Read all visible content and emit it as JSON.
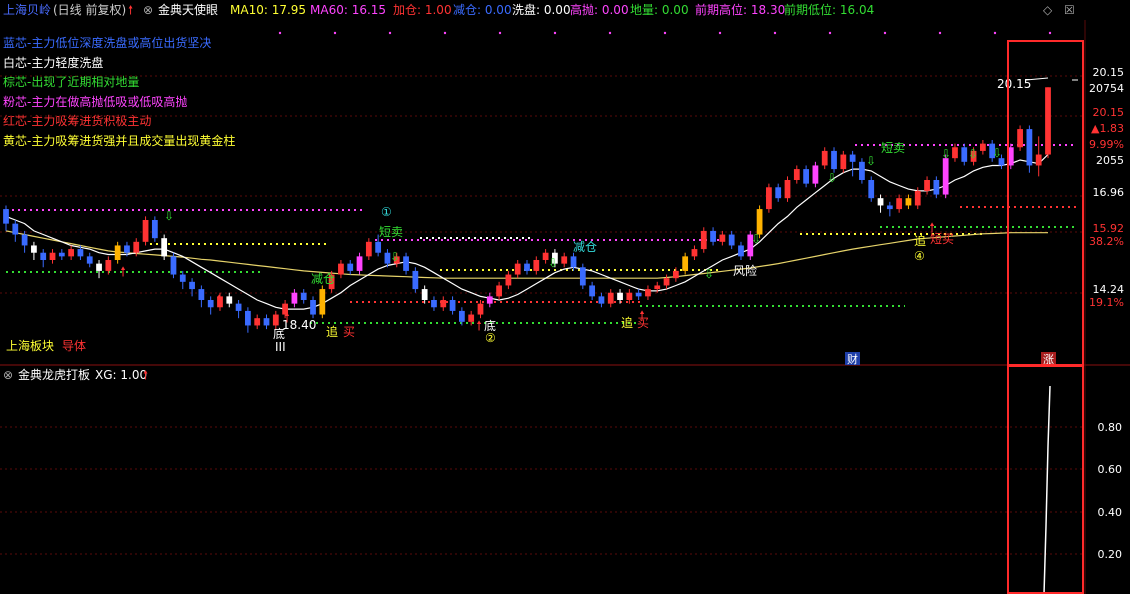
{
  "header": {
    "stock_name": "上海贝岭",
    "period": "(日线 前复权)",
    "indicator_name": "金典天使眼",
    "ma10_label": "MA10: 17.95",
    "ma60_label": "MA60: 16.15",
    "jiacang_label": "加仓: 1.00",
    "jiancang_label": "减仓: 0.00",
    "xipan_label": "洗盘: 0.00",
    "gaopao_label": "高抛: 0.00",
    "diliang_label": "地量: 0.00",
    "qianqi_gao_label": "前期高位: 18.30",
    "qianqi_di_label": "前期低位: 16.04"
  },
  "legend": [
    {
      "text": "蓝芯-主力低位深度洗盘或高位出货坚决",
      "color": "#3a6bff"
    },
    {
      "text": "白芯-主力轻度洗盘",
      "color": "#ffffff"
    },
    {
      "text": "棕芯-出现了近期相对地量",
      "color": "#33dd33"
    },
    {
      "text": "粉芯-主力在做高抛低吸或低吸高抛",
      "color": "#ff44ff"
    },
    {
      "text": "红芯-主力吸筹进货积极主动",
      "color": "#ff3333"
    },
    {
      "text": "黄芯-主力吸筹进货强并且成交量出现黄金柱",
      "color": "#ffff33"
    }
  ],
  "annotations": {
    "di_1": "底",
    "di_1_num": "III",
    "low_1": "18.40",
    "zhui_mai_1": "追",
    "zhui_mai_1b": "买",
    "jiancang_1": "减仓",
    "circle_1": "①",
    "duanmai_1": "短卖",
    "di_2": "底",
    "circle_2": "②",
    "jiancang_2": "减仓",
    "zhui_mai_2": "追",
    "zhui_mai_2b": "买",
    "fengxian": "风险",
    "duanmai_2": "短卖",
    "zhui_3": "追",
    "duanmai_3": "短买",
    "circle_4": "④",
    "high_price": "20.15",
    "sector": "上海板块",
    "sector_tail": "导体",
    "cai_badge": "财",
    "zhang_badge": "涨"
  },
  "right_axis": {
    "labels": [
      "20.15",
      "20754",
      "20.15",
      "▲1.83",
      "9.99%",
      "2055",
      "16.96",
      "15.92",
      "38.2%",
      "14.24",
      "19.1%"
    ],
    "colors": [
      "#ffffff",
      "#ffffff",
      "#ff3333",
      "#ff3333",
      "#ff3333",
      "#ffffff",
      "#ffffff",
      "#ff3333",
      "#ff3333",
      "#ffffff",
      "#ff3333"
    ]
  },
  "sub_header": {
    "name": "金典龙虎打板",
    "xg_label": "XG: 1.00"
  },
  "sub_axis": {
    "labels": [
      "0.80",
      "0.60",
      "0.40",
      "0.20"
    ]
  },
  "chart_data": {
    "type": "candlestick",
    "price_range": [
      13.2,
      20.9
    ],
    "candles": [
      [
        16.8,
        16.4,
        16.9,
        16.2
      ],
      [
        16.4,
        16.1,
        16.5,
        15.9
      ],
      [
        16.1,
        15.8,
        16.2,
        15.6
      ],
      [
        15.8,
        15.6,
        15.9,
        15.4
      ],
      [
        15.6,
        15.4,
        15.7,
        15.2
      ],
      [
        15.4,
        15.6,
        15.7,
        15.3
      ],
      [
        15.6,
        15.5,
        15.7,
        15.4
      ],
      [
        15.5,
        15.7,
        15.8,
        15.4
      ],
      [
        15.7,
        15.5,
        15.8,
        15.4
      ],
      [
        15.5,
        15.3,
        15.6,
        15.2
      ],
      [
        15.3,
        15.1,
        15.4,
        14.9
      ],
      [
        15.1,
        15.4,
        15.5,
        15.0
      ],
      [
        15.4,
        15.8,
        15.9,
        15.3
      ],
      [
        15.8,
        15.6,
        15.9,
        15.5
      ],
      [
        15.6,
        15.9,
        16.0,
        15.5
      ],
      [
        15.9,
        16.5,
        16.6,
        15.8
      ],
      [
        16.5,
        16.0,
        16.6,
        15.9
      ],
      [
        16.0,
        15.5,
        16.1,
        15.4
      ],
      [
        15.5,
        15.0,
        15.6,
        14.9
      ],
      [
        15.0,
        14.8,
        15.1,
        14.6
      ],
      [
        14.8,
        14.6,
        14.9,
        14.4
      ],
      [
        14.6,
        14.3,
        14.7,
        14.1
      ],
      [
        14.3,
        14.1,
        14.4,
        13.9
      ],
      [
        14.1,
        14.4,
        14.5,
        14.0
      ],
      [
        14.4,
        14.2,
        14.5,
        14.1
      ],
      [
        14.2,
        14.0,
        14.3,
        13.8
      ],
      [
        14.0,
        13.6,
        14.1,
        13.4
      ],
      [
        13.6,
        13.8,
        13.9,
        13.5
      ],
      [
        13.8,
        13.6,
        13.9,
        13.5
      ],
      [
        13.6,
        13.9,
        14.0,
        13.5
      ],
      [
        13.9,
        14.2,
        14.3,
        13.8
      ],
      [
        14.2,
        14.5,
        14.6,
        14.1
      ],
      [
        14.5,
        14.3,
        14.6,
        14.2
      ],
      [
        14.3,
        13.9,
        14.4,
        13.8
      ],
      [
        13.9,
        14.6,
        14.7,
        13.8
      ],
      [
        14.6,
        15.0,
        15.1,
        14.5
      ],
      [
        15.0,
        15.3,
        15.4,
        14.9
      ],
      [
        15.3,
        15.1,
        15.4,
        15.0
      ],
      [
        15.1,
        15.5,
        15.6,
        15.0
      ],
      [
        15.5,
        15.9,
        16.0,
        15.4
      ],
      [
        15.9,
        15.6,
        16.1,
        15.5
      ],
      [
        15.6,
        15.3,
        15.7,
        15.2
      ],
      [
        15.3,
        15.5,
        15.6,
        15.2
      ],
      [
        15.5,
        15.1,
        15.6,
        15.0
      ],
      [
        15.1,
        14.6,
        15.2,
        14.5
      ],
      [
        14.6,
        14.3,
        14.7,
        14.2
      ],
      [
        14.3,
        14.1,
        14.4,
        14.0
      ],
      [
        14.1,
        14.3,
        14.4,
        14.0
      ],
      [
        14.3,
        14.0,
        14.4,
        13.9
      ],
      [
        14.0,
        13.7,
        14.1,
        13.6
      ],
      [
        13.7,
        13.9,
        14.0,
        13.6
      ],
      [
        13.9,
        14.2,
        14.3,
        13.8
      ],
      [
        14.2,
        14.4,
        14.5,
        14.1
      ],
      [
        14.4,
        14.7,
        14.8,
        14.3
      ],
      [
        14.7,
        15.0,
        15.1,
        14.6
      ],
      [
        15.0,
        15.3,
        15.4,
        14.9
      ],
      [
        15.3,
        15.1,
        15.4,
        15.0
      ],
      [
        15.1,
        15.4,
        15.5,
        15.0
      ],
      [
        15.4,
        15.6,
        15.7,
        15.3
      ],
      [
        15.6,
        15.3,
        15.7,
        15.2
      ],
      [
        15.3,
        15.5,
        15.6,
        15.2
      ],
      [
        15.5,
        15.2,
        15.6,
        15.1
      ],
      [
        15.2,
        14.7,
        15.3,
        14.6
      ],
      [
        14.7,
        14.4,
        14.8,
        14.3
      ],
      [
        14.4,
        14.2,
        14.5,
        14.1
      ],
      [
        14.2,
        14.5,
        14.6,
        14.1
      ],
      [
        14.5,
        14.3,
        14.6,
        14.2
      ],
      [
        14.3,
        14.5,
        14.6,
        14.2
      ],
      [
        14.5,
        14.4,
        14.6,
        14.3
      ],
      [
        14.4,
        14.6,
        14.7,
        14.3
      ],
      [
        14.6,
        14.7,
        14.8,
        14.5
      ],
      [
        14.7,
        14.9,
        15.0,
        14.6
      ],
      [
        14.9,
        15.1,
        15.2,
        14.8
      ],
      [
        15.1,
        15.5,
        15.6,
        15.0
      ],
      [
        15.5,
        15.7,
        15.8,
        15.4
      ],
      [
        15.7,
        16.2,
        16.3,
        15.6
      ],
      [
        16.2,
        15.9,
        16.3,
        15.8
      ],
      [
        15.9,
        16.1,
        16.2,
        15.8
      ],
      [
        16.1,
        15.8,
        16.2,
        15.7
      ],
      [
        15.8,
        15.5,
        15.9,
        15.4
      ],
      [
        15.5,
        16.1,
        16.2,
        15.4
      ],
      [
        16.1,
        16.8,
        16.9,
        16.0
      ],
      [
        16.8,
        17.4,
        17.5,
        16.7
      ],
      [
        17.4,
        17.1,
        17.5,
        17.0
      ],
      [
        17.1,
        17.6,
        17.7,
        17.0
      ],
      [
        17.6,
        17.9,
        18.0,
        17.5
      ],
      [
        17.9,
        17.5,
        18.0,
        17.4
      ],
      [
        17.5,
        18.0,
        18.1,
        17.4
      ],
      [
        18.0,
        18.4,
        18.5,
        17.9
      ],
      [
        18.4,
        17.9,
        18.5,
        17.8
      ],
      [
        17.9,
        18.3,
        18.4,
        17.8
      ],
      [
        18.3,
        18.1,
        18.4,
        17.7
      ],
      [
        18.1,
        17.6,
        18.2,
        17.5
      ],
      [
        17.6,
        17.1,
        17.7,
        17.0
      ],
      [
        17.1,
        16.9,
        17.2,
        16.7
      ],
      [
        16.9,
        16.8,
        17.0,
        16.6
      ],
      [
        16.8,
        17.1,
        17.2,
        16.7
      ],
      [
        17.1,
        16.9,
        17.2,
        16.8
      ],
      [
        16.9,
        17.3,
        17.4,
        16.8
      ],
      [
        17.3,
        17.6,
        17.7,
        17.2
      ],
      [
        17.6,
        17.2,
        17.7,
        17.1
      ],
      [
        17.2,
        18.2,
        18.3,
        17.1
      ],
      [
        18.2,
        18.5,
        18.6,
        18.1
      ],
      [
        18.5,
        18.1,
        18.6,
        18.0
      ],
      [
        18.1,
        18.4,
        18.5,
        18.0
      ],
      [
        18.4,
        18.6,
        18.7,
        18.3
      ],
      [
        18.6,
        18.2,
        18.7,
        18.1
      ],
      [
        18.2,
        18.0,
        18.3,
        17.9
      ],
      [
        18.0,
        18.5,
        18.6,
        17.9
      ],
      [
        18.5,
        19.0,
        19.1,
        18.4
      ],
      [
        19.0,
        18.0,
        19.1,
        17.8
      ],
      [
        18.0,
        18.3,
        18.8,
        17.7
      ],
      [
        18.3,
        20.15,
        20.15,
        18.2
      ]
    ],
    "ma10": [
      16.6,
      16.5,
      16.4,
      16.2,
      16.1,
      16.0,
      15.9,
      15.8,
      15.75,
      15.7,
      15.6,
      15.55,
      15.55,
      15.55,
      15.6,
      15.65,
      15.7,
      15.7,
      15.6,
      15.5,
      15.35,
      15.2,
      15.05,
      14.9,
      14.75,
      14.6,
      14.45,
      14.3,
      14.2,
      14.1,
      14.05,
      14.05,
      14.05,
      14.1,
      14.2,
      14.35,
      14.5,
      14.7,
      14.85,
      15.0,
      15.15,
      15.25,
      15.3,
      15.35,
      15.3,
      15.2,
      15.05,
      14.9,
      14.75,
      14.6,
      14.5,
      14.4,
      14.35,
      14.3,
      14.35,
      14.45,
      14.6,
      14.75,
      14.9,
      15.05,
      15.15,
      15.2,
      15.15,
      15.1,
      15.0,
      14.9,
      14.8,
      14.7,
      14.6,
      14.55,
      14.55,
      14.6,
      14.7,
      14.8,
      14.95,
      15.1,
      15.25,
      15.4,
      15.5,
      15.6,
      15.7,
      15.9,
      16.15,
      16.4,
      16.6,
      16.85,
      17.05,
      17.25,
      17.45,
      17.65,
      17.8,
      17.9,
      17.9,
      17.85,
      17.7,
      17.55,
      17.45,
      17.35,
      17.3,
      17.3,
      17.35,
      17.45,
      17.6,
      17.7,
      17.85,
      17.95,
      18.0,
      18.0,
      18.05,
      18.15,
      18.1,
      18.05,
      18.3
    ],
    "ma60": [
      16.2,
      16.15,
      16.1,
      16.05,
      16.0,
      15.95,
      15.9,
      15.85,
      15.8,
      15.75,
      15.7,
      15.65,
      15.62,
      15.6,
      15.58,
      15.56,
      15.54,
      15.52,
      15.5,
      15.48,
      15.45,
      15.42,
      15.4,
      15.37,
      15.34,
      15.31,
      15.28,
      15.25,
      15.22,
      15.19,
      15.16,
      15.13,
      15.1,
      15.08,
      15.06,
      15.04,
      15.02,
      15.0,
      14.99,
      14.98,
      14.97,
      14.96,
      14.95,
      14.94,
      14.93,
      14.92,
      14.91,
      14.9,
      14.9,
      14.9,
      14.9,
      14.9,
      14.9,
      14.9,
      14.9,
      14.9,
      14.9,
      14.9,
      14.9,
      14.9,
      14.9,
      14.9,
      14.9,
      14.9,
      14.9,
      14.9,
      14.9,
      14.9,
      14.9,
      14.9,
      14.9,
      14.92,
      14.94,
      14.97,
      15.0,
      15.03,
      15.06,
      15.09,
      15.12,
      15.15,
      15.18,
      15.22,
      15.26,
      15.3,
      15.35,
      15.4,
      15.45,
      15.5,
      15.55,
      15.6,
      15.65,
      15.7,
      15.74,
      15.78,
      15.82,
      15.86,
      15.9,
      15.94,
      15.98,
      16.0,
      16.02,
      16.04,
      16.06,
      16.08,
      16.1,
      16.12,
      16.13,
      16.14,
      16.15,
      16.15,
      16.15,
      16.15,
      16.15
    ],
    "sub_signal": {
      "name": "XG",
      "value": 1.0,
      "ylim": [
        0,
        1.0
      ]
    }
  }
}
